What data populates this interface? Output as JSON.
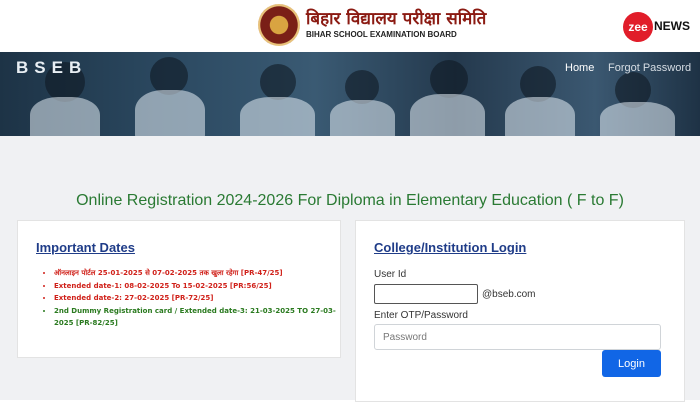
{
  "header": {
    "org_name_hindi": "बिहार विद्यालय परीक्षा समिति",
    "org_name_english": "BIHAR SCHOOL EXAMINATION BOARD",
    "watermark_circle": "zee",
    "watermark_text": "NEWS"
  },
  "navbar": {
    "brand": "BSEB",
    "home": "Home",
    "forgot_password": "Forgot Password"
  },
  "page_heading": "Online Registration 2024-2026 For Diploma in Elementary Education ( F to F)",
  "important_dates": {
    "title": "Important Dates",
    "items": [
      {
        "text": "ऑनलाइन पोर्टल 25-01-2025 से 07-02-2025 तक खुला रहेगा [PR-47/25]",
        "color": "#d0211a"
      },
      {
        "text": "Extended date-1: 08-02-2025 To 15-02-2025 [PR:56/25]",
        "color": "#d0211a"
      },
      {
        "text": "Extended date-2: 27-02-2025 [PR-72/25]",
        "color": "#d0211a"
      },
      {
        "text": "2nd Dummy Registration card / Extended date-3: 21-03-2025 TO 27-03-2025 [PR-82/25]",
        "color": "#2a7a1f"
      }
    ]
  },
  "login": {
    "title": "College/Institution Login",
    "user_id_label": "User Id",
    "user_id_value": "",
    "email_suffix": "@bseb.com",
    "otp_label": "Enter OTP/Password",
    "password_placeholder": "Password",
    "button_label": "Login"
  },
  "colors": {
    "heading_green": "#2a7a33",
    "link_blue": "#1f3c88",
    "button_blue": "#1166e6",
    "alert_red": "#d0211a"
  }
}
